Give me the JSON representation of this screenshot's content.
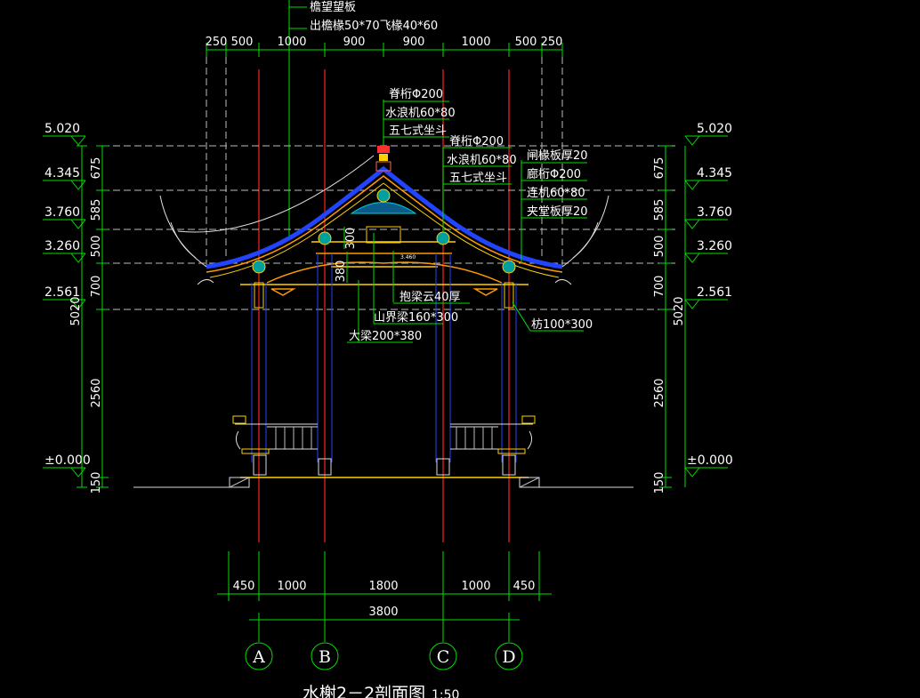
{
  "top_notes": [
    "檐望望板",
    "出檐椽50*70飞椽40*60"
  ],
  "top_dims": [
    "250",
    "500",
    "1000",
    "900",
    "900",
    "1000",
    "500",
    "250"
  ],
  "bottom_dims": [
    "450",
    "1000",
    "1800",
    "1000",
    "450"
  ],
  "total_dim": "3800",
  "grid_axes": [
    "A",
    "B",
    "C",
    "D"
  ],
  "levels": [
    "5.020",
    "4.345",
    "3.760",
    "3.260",
    "2.561",
    "±0.000"
  ],
  "side_dims": [
    "675",
    "585",
    "500",
    "700",
    "2560",
    "150"
  ],
  "total_height": "5020",
  "beam_dims": [
    "300",
    "380"
  ],
  "ridge_labels": [
    "脊桁Φ200",
    "水浪机60*80",
    "五七式坐斗"
  ],
  "mid_labels": [
    "脊桁Φ200",
    "水浪机60*80",
    "五七式坐斗"
  ],
  "right_labels": [
    "闸椽板厚20",
    "廊桁Φ200",
    "连机60*80",
    "夹堂板厚20"
  ],
  "lower_labels": [
    "抱梁云40厚",
    "山界梁160*300",
    "大梁200*380"
  ],
  "tie_label": "枋100*300",
  "small_level": "3.460",
  "caption": "水榭2－2剖面图",
  "caption_scale": "1:50",
  "colors": {
    "dim": "#00e000",
    "axis": "#ff2020",
    "roof": "#2244ff",
    "text": "#ffffff"
  }
}
